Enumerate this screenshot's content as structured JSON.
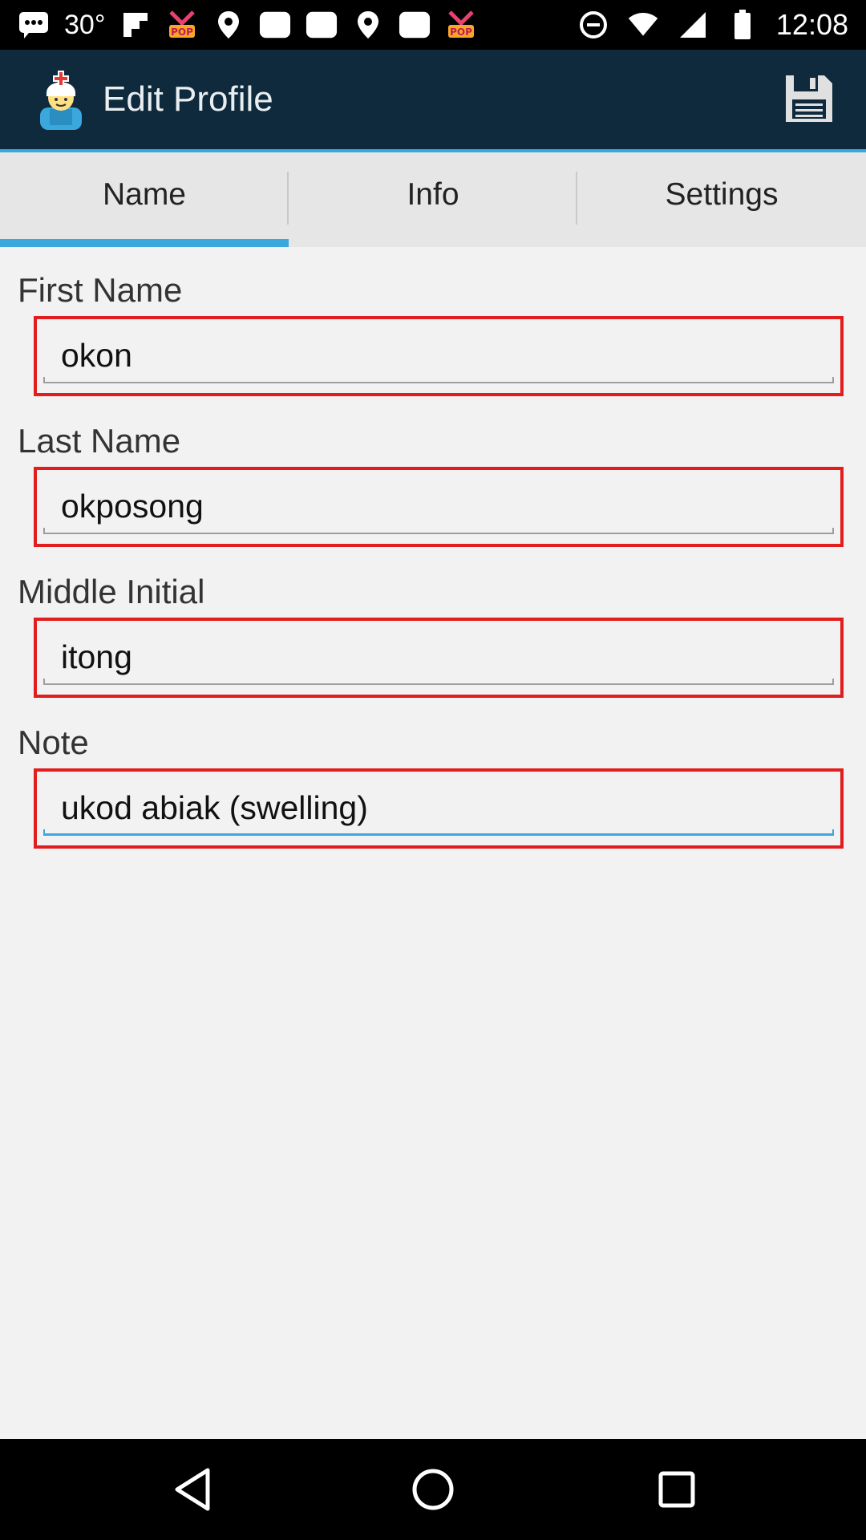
{
  "status_bar": {
    "temperature": "30°",
    "time": "12:08",
    "icons": [
      "messages-icon",
      "temperature-icon",
      "flipboard-icon",
      "pop-icon",
      "location-icon",
      "square-icon",
      "square-icon",
      "location-icon",
      "square-icon",
      "pop-icon",
      "do-not-disturb-icon",
      "wifi-icon",
      "signal-icon",
      "battery-icon"
    ]
  },
  "action_bar": {
    "title": "Edit Profile",
    "app_icon": "nurse-icon",
    "save_icon": "floppy-disk-icon",
    "background": "#0e2a3c",
    "accent": "#3aa8dc"
  },
  "tabs": [
    {
      "label": "Name",
      "active": true
    },
    {
      "label": "Info",
      "active": false
    },
    {
      "label": "Settings",
      "active": false
    }
  ],
  "fields": {
    "first_name": {
      "label": "First Name",
      "value": "okon"
    },
    "last_name": {
      "label": "Last Name",
      "value": "okposong"
    },
    "middle_initial": {
      "label": "Middle Initial",
      "value": "itong"
    },
    "note": {
      "label": "Note",
      "value": "ukod abiak (swelling)",
      "focused": true
    }
  },
  "highlight_color": "#e21d1d",
  "nav_bar": {
    "buttons": [
      "back-icon",
      "home-icon",
      "recents-icon"
    ]
  }
}
